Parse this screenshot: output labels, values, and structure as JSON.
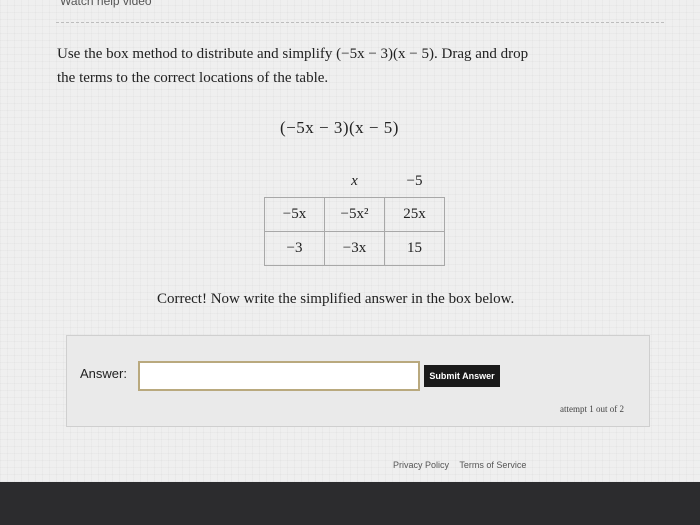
{
  "header": {
    "help_link": "Watch help video"
  },
  "question": {
    "line1": "Use the box method to distribute and simplify (−5x − 3)(x − 5). Drag and drop",
    "line2": "the terms to the correct locations of the table."
  },
  "expression": "(−5x − 3)(x − 5)",
  "box_table": {
    "col_headers": [
      "x",
      "−5"
    ],
    "rows": [
      {
        "row_header": "−5x",
        "cells": [
          "−5x²",
          "25x"
        ]
      },
      {
        "row_header": "−3",
        "cells": [
          "−3x",
          "15"
        ]
      }
    ]
  },
  "feedback": "Correct! Now write the simplified answer in the box below.",
  "answer": {
    "label": "Answer:",
    "value": "",
    "submit_label": "Submit Answer",
    "attempt_text": "attempt 1 out of 2"
  },
  "footer": {
    "privacy": "Privacy Policy",
    "terms": "Terms of Service"
  }
}
